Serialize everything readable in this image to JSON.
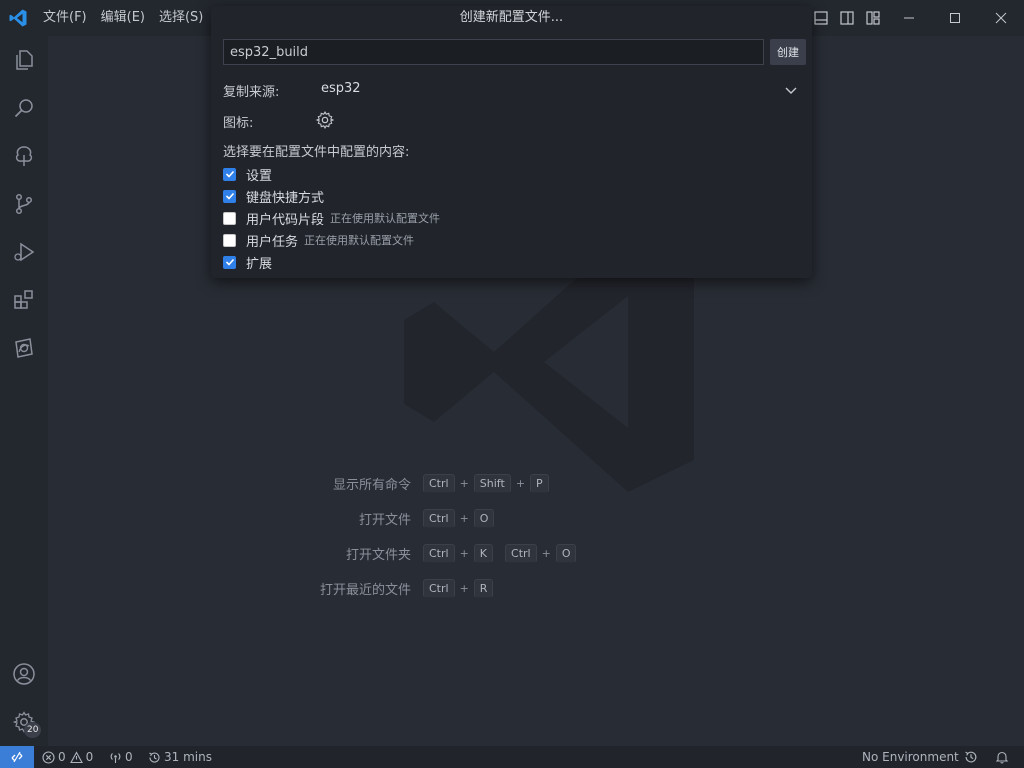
{
  "menu": [
    "文件(F)",
    "编辑(E)",
    "选择(S)"
  ],
  "dialog": {
    "title": "创建新配置文件...",
    "name_value": "esp32_build",
    "create_label": "创建",
    "copy_from_label": "复制来源:",
    "copy_from_value": "esp32",
    "icon_label": "图标:",
    "contents_label": "选择要在配置文件中配置的内容:",
    "options": [
      {
        "label": "设置",
        "checked": true,
        "hint": ""
      },
      {
        "label": "键盘快捷方式",
        "checked": true,
        "hint": ""
      },
      {
        "label": "用户代码片段",
        "checked": false,
        "hint": "正在使用默认配置文件"
      },
      {
        "label": "用户任务",
        "checked": false,
        "hint": "正在使用默认配置文件"
      },
      {
        "label": "扩展",
        "checked": true,
        "hint": ""
      }
    ]
  },
  "shortcuts": [
    {
      "label": "显示所有命令",
      "keys": [
        [
          "Ctrl",
          "Shift",
          "P"
        ]
      ]
    },
    {
      "label": "打开文件",
      "keys": [
        [
          "Ctrl",
          "O"
        ]
      ]
    },
    {
      "label": "打开文件夹",
      "keys": [
        [
          "Ctrl",
          "K"
        ],
        [
          "Ctrl",
          "O"
        ]
      ]
    },
    {
      "label": "打开最近的文件",
      "keys": [
        [
          "Ctrl",
          "R"
        ]
      ]
    }
  ],
  "activity": {
    "settings_badge": "20"
  },
  "statusbar": {
    "errors": "0",
    "warnings": "0",
    "ports": "0",
    "time": "31 mins",
    "environment": "No Environment"
  },
  "colors": {
    "accent": "#3b7ed8",
    "checkbox": "#2f80e8"
  }
}
